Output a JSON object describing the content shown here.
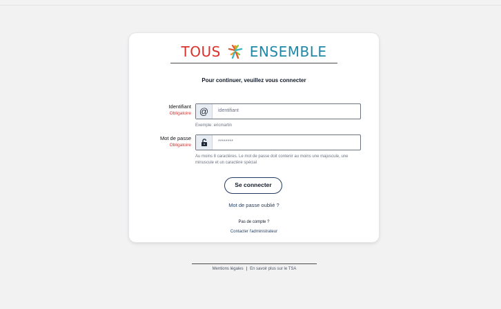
{
  "brand": {
    "word1": "TOUS",
    "word2": "ENSEMBLE",
    "primary_color": "#d9302b",
    "secondary_color": "#1e88a8"
  },
  "form": {
    "heading": "Pour continuer, veuillez vous connecter",
    "identifier": {
      "label": "Identifiant",
      "required": "Obligatoire",
      "icon": "at-icon",
      "placeholder": "identifiant",
      "hint": "Exemple: ericmartin"
    },
    "password": {
      "label": "Mot de passe",
      "required": "Obligatoire",
      "icon": "unlock-icon",
      "value": "********",
      "hint": "Au moins 8 caractères. Le mot de passe doit contenir au moins une majuscule, une minuscule et un caractère spécial"
    },
    "submit_label": "Se connecter",
    "forgot_label": "Mot de passe oublié ?",
    "no_account": "Pas de compte ?",
    "contact_label": "Contacter l'administrateur"
  },
  "footer": {
    "legal": "Mentions légales",
    "separator": "|",
    "more": "En savoir plus sur le TSA"
  }
}
